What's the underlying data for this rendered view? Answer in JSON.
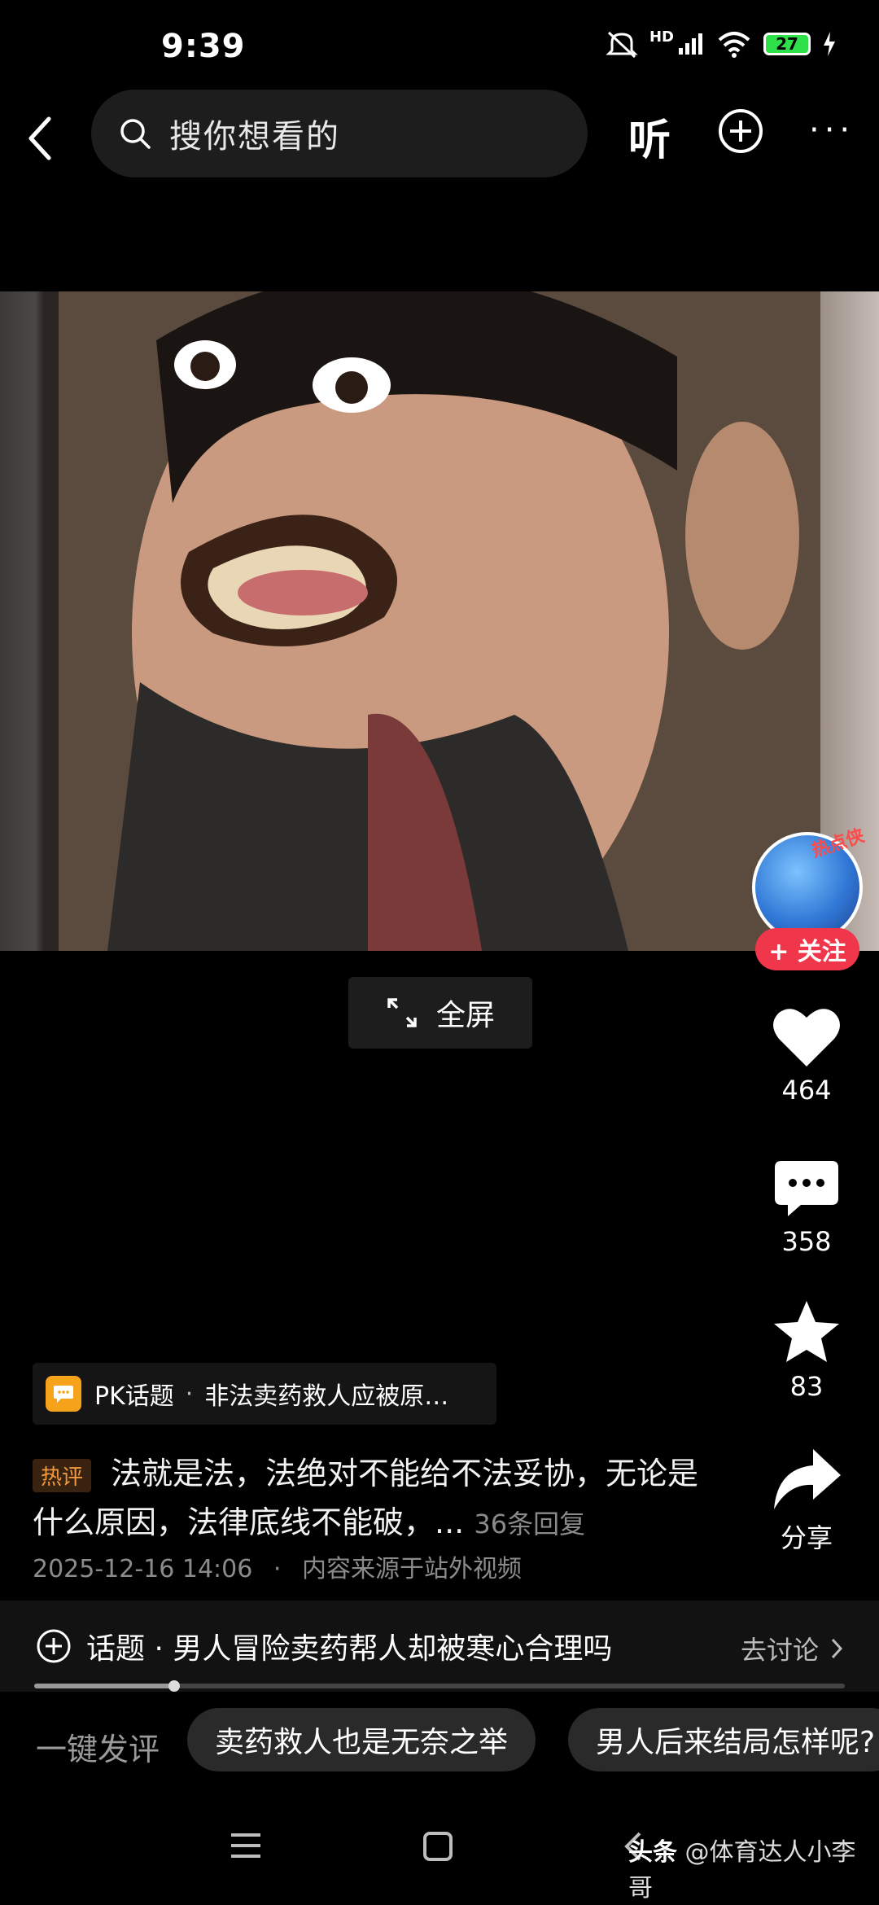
{
  "status": {
    "time": "9:39",
    "battery": "27",
    "network": "HD"
  },
  "header": {
    "search_placeholder": "搜你想看的",
    "listen_label": "听"
  },
  "video": {
    "fullscreen_label": "全屏"
  },
  "author": {
    "badge": "热点侠",
    "follow_label": "+ 关注"
  },
  "actions": {
    "likes": "464",
    "comments": "358",
    "favorites": "83",
    "share_label": "分享"
  },
  "pk_topic": {
    "label": "PK话题",
    "text": "非法卖药救人应被原…"
  },
  "hot_comment": {
    "tag": "热评",
    "text": "法就是法，法绝对不能给不法妥协，无论是什么原因，法律底线不能破，...",
    "replies": "36条回复"
  },
  "meta": {
    "date": "2025-12-16 14:06",
    "source": "内容来源于站外视频"
  },
  "topic_bar": {
    "text": "话题 · 男人冒险卖药帮人却被寒心合理吗",
    "action": "去讨论"
  },
  "progress": {
    "fraction": 0.173
  },
  "quick_comment": {
    "label": "一键发评",
    "chips": [
      "卖药救人也是无奈之举",
      "男人后来结局怎样呢?"
    ]
  },
  "watermark": {
    "brand": "头条",
    "account": "@体育达人小李哥"
  }
}
